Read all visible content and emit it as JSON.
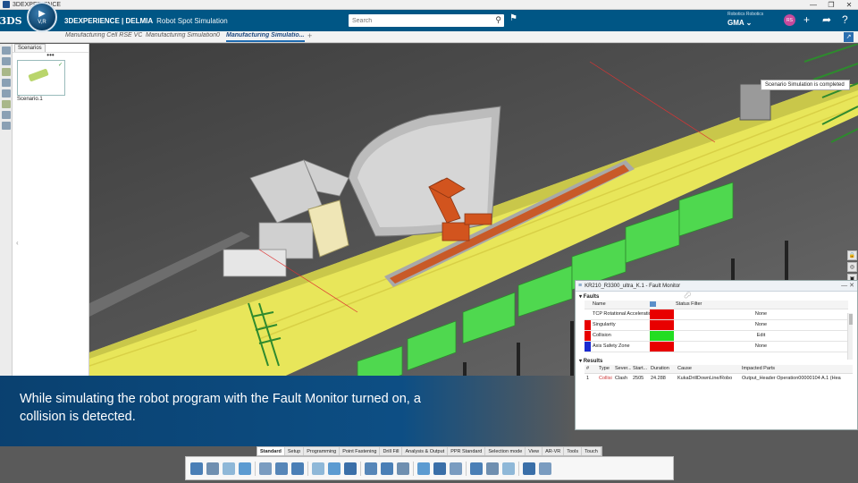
{
  "os": {
    "title": "3DEXPERIENCE",
    "controls": [
      "—",
      "❐",
      "✕"
    ]
  },
  "header": {
    "logo": "3DS",
    "compass_vr": "V,R",
    "brand_strong": "3DEXPERIENCE | DELMIA",
    "app_name": "Robot Spot Simulation",
    "search_placeholder": "Search",
    "user_context": "Robotics  Robotics",
    "user_role": "GMA ⌄",
    "avatar_initials": "RS",
    "icons": [
      "tag-icon",
      "add-icon",
      "share-icon",
      "help-icon"
    ]
  },
  "tabs": [
    {
      "label": "Manufacturing Cell RSE VC",
      "active": false
    },
    {
      "label": "Manufacturing Simulation0",
      "active": false
    },
    {
      "label": "Manufacturing Simulatio...",
      "active": true
    }
  ],
  "tab_plus": "+",
  "scenarios_panel": {
    "tab_label": "Scenarios",
    "more": "•••",
    "items": [
      {
        "label": "Scenario.1"
      }
    ]
  },
  "toast": "Scenario Simulation is completed",
  "fault_monitor": {
    "title": "KR210_R3300_ultra_K.1 - Fault Monitor",
    "faults_label": "Faults",
    "faults_headers": {
      "name": "Name",
      "status": "Status",
      "filter": "Filter"
    },
    "faults": [
      {
        "name": "TCP Rotational Acceleration",
        "indicator": "#ffffff",
        "status_color": "#e80000",
        "filter": "None"
      },
      {
        "name": "Singularity",
        "indicator": "#e80000",
        "status_color": "#e80000",
        "filter": "None"
      },
      {
        "name": "Collision",
        "indicator": "#e80000",
        "status_color": "#22dd22",
        "filter": "Edit"
      },
      {
        "name": "Axis Safety Zone",
        "indicator": "#1a2ad0",
        "status_color": "#e80000",
        "filter": "None"
      }
    ],
    "results_label": "Results",
    "results_headers": [
      "#",
      "Type",
      "Sever...",
      "Start...",
      "Duration",
      "Cause",
      "Impacted Parts"
    ],
    "results": [
      [
        "1",
        "Collisi",
        "Clash",
        "2505",
        "24.288",
        "KukaDrillDownLine/Robo",
        "Output_Header Operation00000104 A.1 (Hea"
      ]
    ]
  },
  "caption": "While simulating the robot program with the Fault Monitor turned on, a collision is detected.",
  "section_tabs": [
    {
      "label": "Standard",
      "active": true
    },
    {
      "label": "Setup",
      "active": false
    },
    {
      "label": "Programming",
      "active": false
    },
    {
      "label": "Point Fastening",
      "active": false
    },
    {
      "label": "Drill Fill",
      "active": false
    },
    {
      "label": "Analysis & Output",
      "active": false
    },
    {
      "label": "PPR Standard",
      "active": false
    },
    {
      "label": "Selection mode",
      "active": false
    },
    {
      "label": "View",
      "active": false
    },
    {
      "label": "AR-VR",
      "active": false
    },
    {
      "label": "Tools",
      "active": false
    },
    {
      "label": "Touch",
      "active": false
    }
  ],
  "colors": {
    "header": "#005685",
    "caption": "#0a4e86",
    "floor": "#e8e65a",
    "racks": "#4fd84f",
    "robot": "#d2541e"
  }
}
